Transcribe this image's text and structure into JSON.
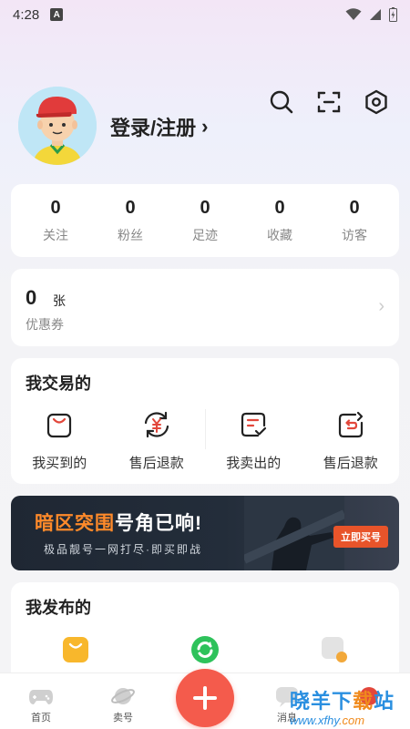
{
  "status_bar": {
    "time": "4:28",
    "badge": "A"
  },
  "profile": {
    "login_label": "登录/注册",
    "chevron": "›"
  },
  "stats": [
    {
      "value": "0",
      "label": "关注"
    },
    {
      "value": "0",
      "label": "粉丝"
    },
    {
      "value": "0",
      "label": "足迹"
    },
    {
      "value": "0",
      "label": "收藏"
    },
    {
      "value": "0",
      "label": "访客"
    }
  ],
  "coupon": {
    "value": "0",
    "unit": "张",
    "label": "优惠券",
    "chevron": "›"
  },
  "trade": {
    "title": "我交易的",
    "items": [
      {
        "label": "我买到的",
        "icon": "shopping-bag-icon"
      },
      {
        "label": "售后退款",
        "icon": "yuan-refresh-icon"
      },
      {
        "label": "我卖出的",
        "icon": "sold-list-icon"
      },
      {
        "label": "售后退款",
        "icon": "refund-bag-icon"
      }
    ]
  },
  "banner": {
    "headline_highlight": "暗区突围",
    "headline_rest": "号角已响!",
    "subtitle": "极品靓号一网打尽·即买即战",
    "cta": "立即买号"
  },
  "published": {
    "title": "我发布的"
  },
  "tabbar": [
    {
      "label": "首页",
      "icon": "gamepad-icon"
    },
    {
      "label": "卖号",
      "icon": "planet-icon"
    },
    {
      "label": "",
      "icon": "plus-icon"
    },
    {
      "label": "消息",
      "icon": "message-icon"
    },
    {
      "label": "",
      "icon": "profile-icon"
    }
  ],
  "watermark": {
    "title_blue": "晓羊下",
    "title_orange": "载",
    "title_end": "站",
    "url_prefix": "www.xfhy",
    "url_suffix": ".com"
  },
  "colors": {
    "accent": "#f45b4c",
    "banner_orange": "#ff8a2a",
    "icon_red": "#e2473b"
  }
}
